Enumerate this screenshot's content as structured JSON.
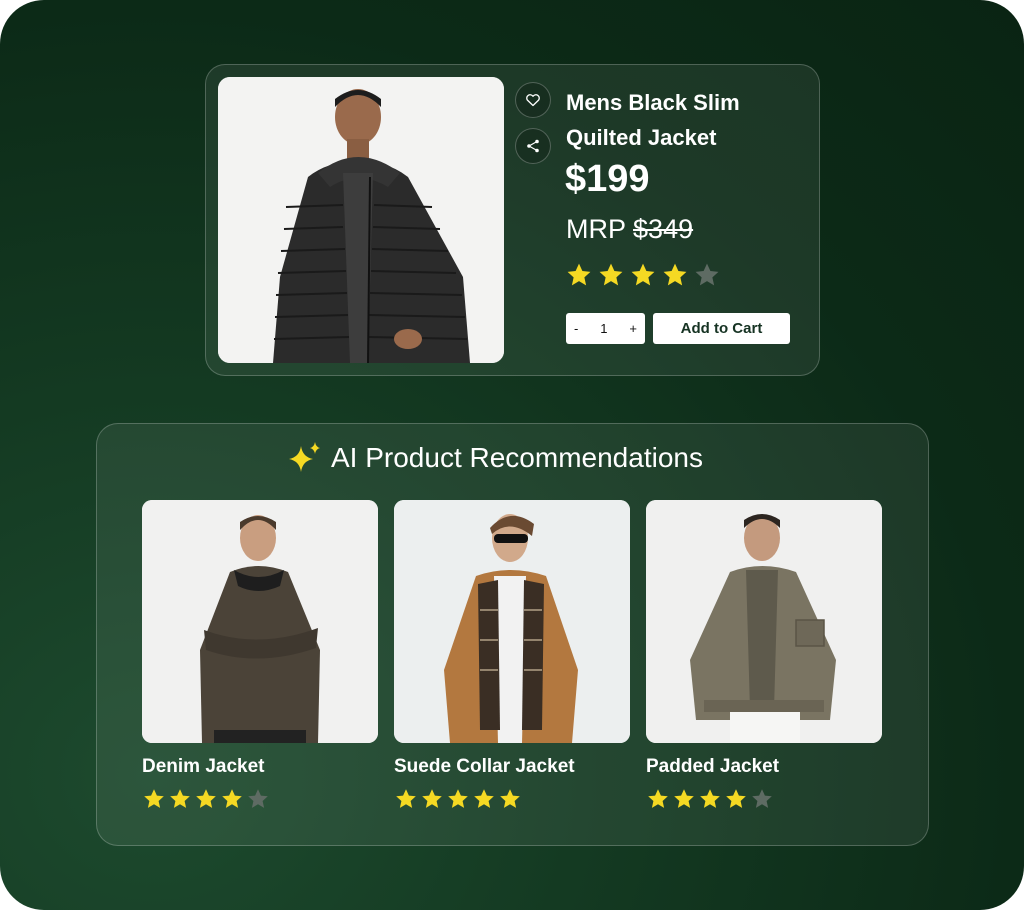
{
  "colors": {
    "background": "#0c2a17",
    "star_filled": "#f5d923",
    "star_empty": "#5e6b63",
    "button_bg": "#ffffff",
    "button_text": "#163323"
  },
  "product": {
    "title_line1": "Mens Black Slim",
    "title_line2": "Quilted Jacket",
    "price": "$199",
    "mrp_label": "MRP",
    "mrp_value": "$349",
    "rating": 4,
    "rating_max": 5,
    "quantity": {
      "minus": "-",
      "value": "1",
      "plus": "+"
    },
    "add_to_cart_label": "Add to Cart",
    "icons": {
      "wishlist": "heart-icon",
      "share": "share-icon"
    }
  },
  "recommendations": {
    "heading": "AI Product Recommendations",
    "heading_icon": "sparkle-icon",
    "items": [
      {
        "name": "Denim Jacket",
        "rating": 4,
        "rating_max": 5
      },
      {
        "name": "Suede Collar Jacket",
        "rating": 5,
        "rating_max": 5
      },
      {
        "name": "Padded Jacket",
        "rating": 4,
        "rating_max": 5
      }
    ]
  }
}
